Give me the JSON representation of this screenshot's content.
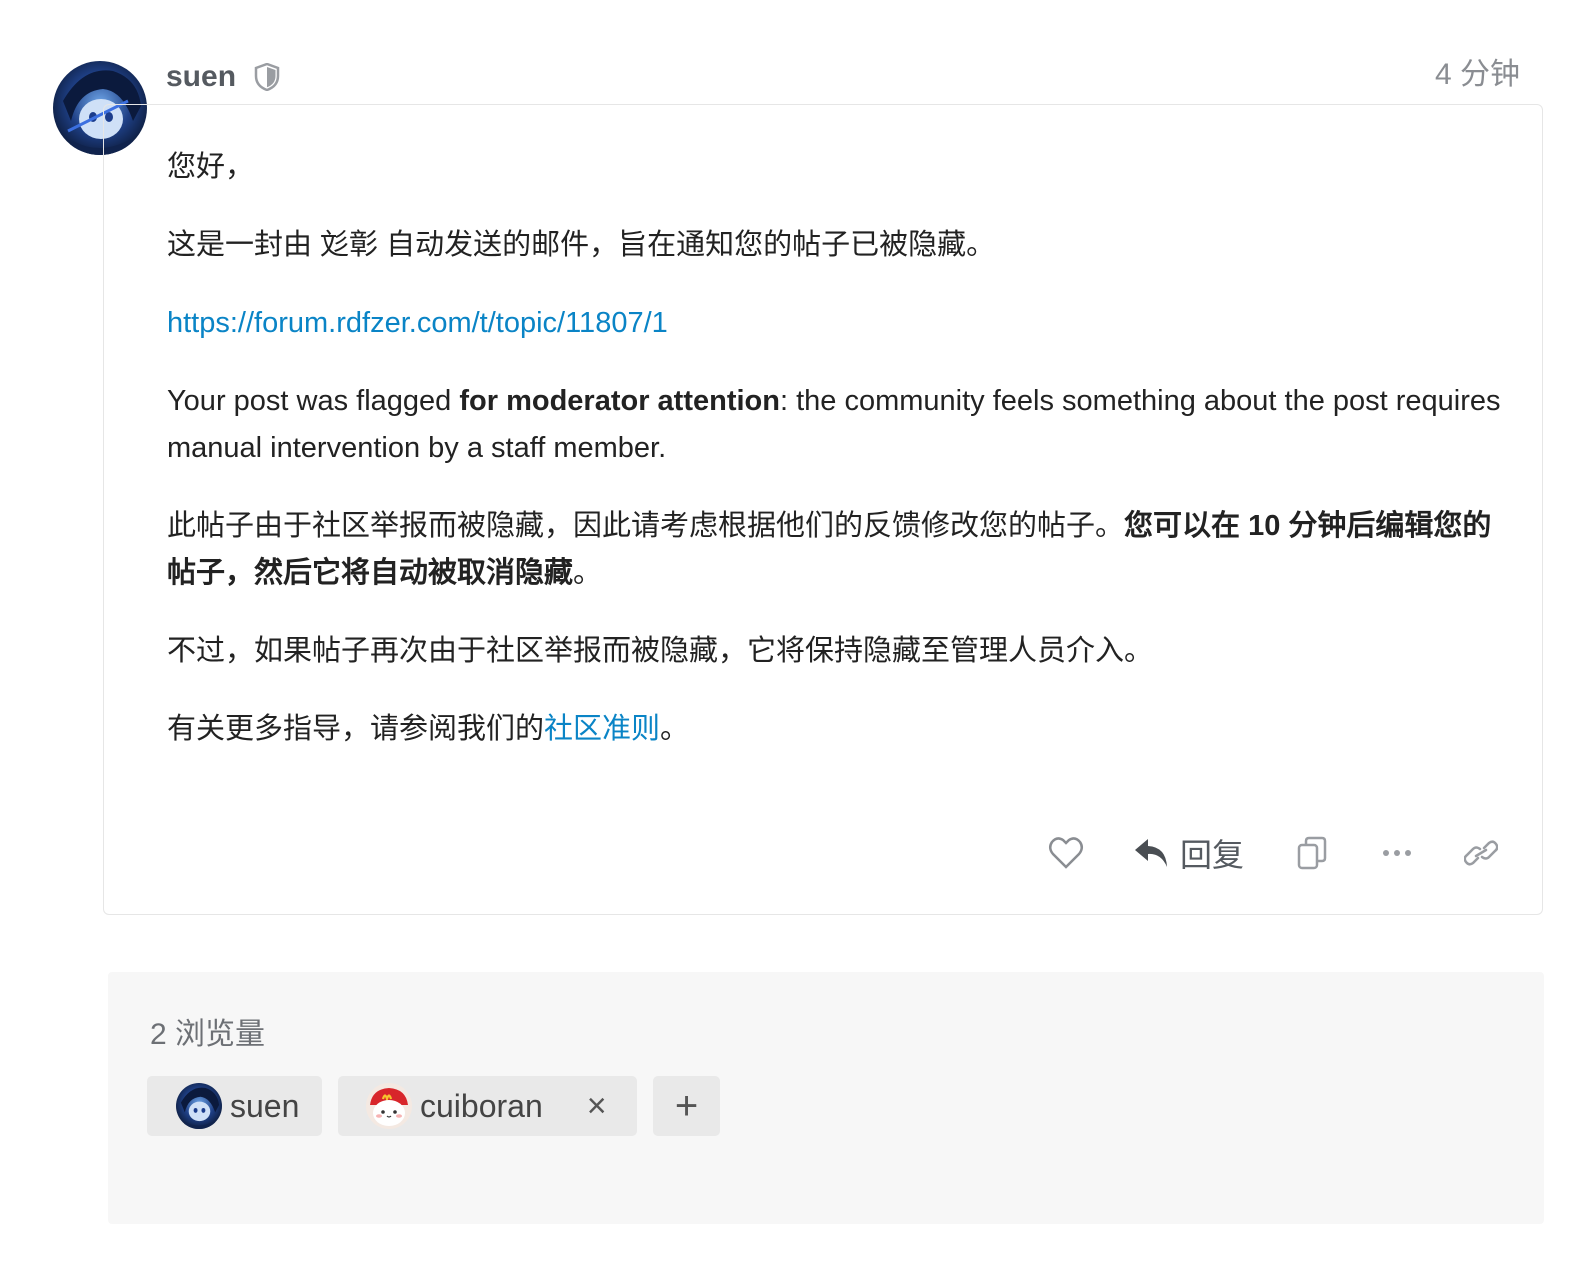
{
  "post": {
    "author": "suen",
    "time": "4 分钟",
    "greeting": "您好，",
    "intro": "这是一封由 彣彰 自动发送的邮件，旨在通知您的帖子已被隐藏。",
    "link": "https://forum.rdfzer.com/t/topic/11807/1",
    "en_before": "Your post was flagged ",
    "en_bold": "for moderator attention",
    "en_after": ": the community feels something about the post requires manual intervention by a staff member.",
    "cn1_normal": "此帖子由于社区举报而被隐藏，因此请考虑根据他们的反馈修改您的帖子。",
    "cn1_bold": "您可以在 10 分钟后编辑您的帖子，然后它将自动被取消隐藏",
    "cn1_end": "。",
    "cn2": "不过，如果帖子再次由于社区举报而被隐藏，它将保持隐藏至管理人员介入。",
    "cn3_before": "有关更多指导，请参阅我们的",
    "cn3_link": "社区准则",
    "cn3_after": "。"
  },
  "actions": {
    "reply_label": "回复",
    "icons": [
      "heart-icon",
      "reply-icon",
      "copy-icon",
      "more-icon",
      "link-icon"
    ]
  },
  "views": {
    "label": "2 浏览量",
    "users": [
      {
        "name": "suen"
      },
      {
        "name": "cuiboran",
        "removable": true
      }
    ],
    "remove_symbol": "×",
    "add_symbol": "+"
  },
  "colors": {
    "link": "#0a84c6",
    "muted": "#8a8d92",
    "panel": "#f7f7f7"
  }
}
